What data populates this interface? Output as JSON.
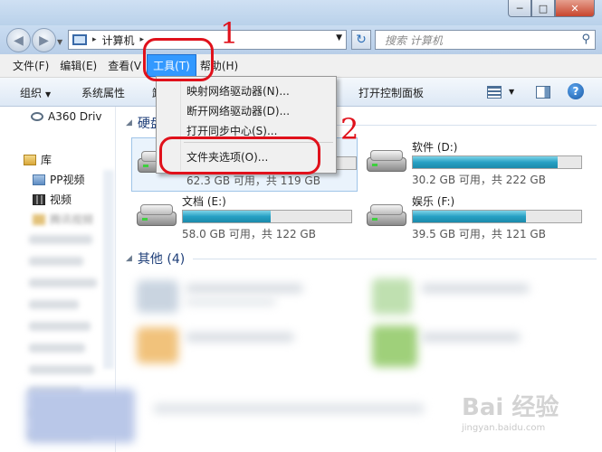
{
  "window": {
    "buttons": [
      "─",
      "□",
      "✕"
    ]
  },
  "nav": {
    "back_icon": "back-arrow-icon",
    "forward_icon": "forward-arrow-icon",
    "breadcrumb": "计算机",
    "breadcrumb_sep": "▸",
    "search_placeholder": "搜索 计算机"
  },
  "menubar": {
    "items": [
      "文件(F)",
      "编辑(E)",
      "查看(V",
      "工具(T)",
      "帮助(H)"
    ],
    "active": "工具(T)"
  },
  "commandbar": {
    "organize": "组织",
    "system_properties": "系统属性",
    "partial": "卸",
    "open_control_panel": "打开控制面板"
  },
  "sidebar": {
    "a360": "A360 Driv",
    "library": "库",
    "pp_video": "PP视频",
    "video": "视频",
    "blurred_1": "腾讯视频"
  },
  "content": {
    "group_hard_disks": "硬盘",
    "group_other": "其他 (4)",
    "drives": [
      {
        "name": "",
        "free_text": "62.3 GB 可用，共 119 GB",
        "used_fraction": 0.48
      },
      {
        "name": "软件 (D:)",
        "free_text": "30.2 GB 可用，共 222 GB",
        "used_fraction": 0.86
      },
      {
        "name": "文档 (E:)",
        "free_text": "58.0 GB 可用，共 122 GB",
        "used_fraction": 0.52
      },
      {
        "name": "娱乐 (F:)",
        "free_text": "39.5 GB 可用，共 121 GB",
        "used_fraction": 0.67
      }
    ]
  },
  "tools_menu": {
    "items": [
      "映射网络驱动器(N)...",
      "断开网络驱动器(D)...",
      "打开同步中心(S)...",
      "文件夹选项(O)..."
    ]
  },
  "annotations": {
    "step1": "1",
    "step2": "2",
    "color": "#e0111b"
  },
  "watermark": {
    "text": "Bai 经验",
    "url": "jingyan.baidu.com"
  }
}
